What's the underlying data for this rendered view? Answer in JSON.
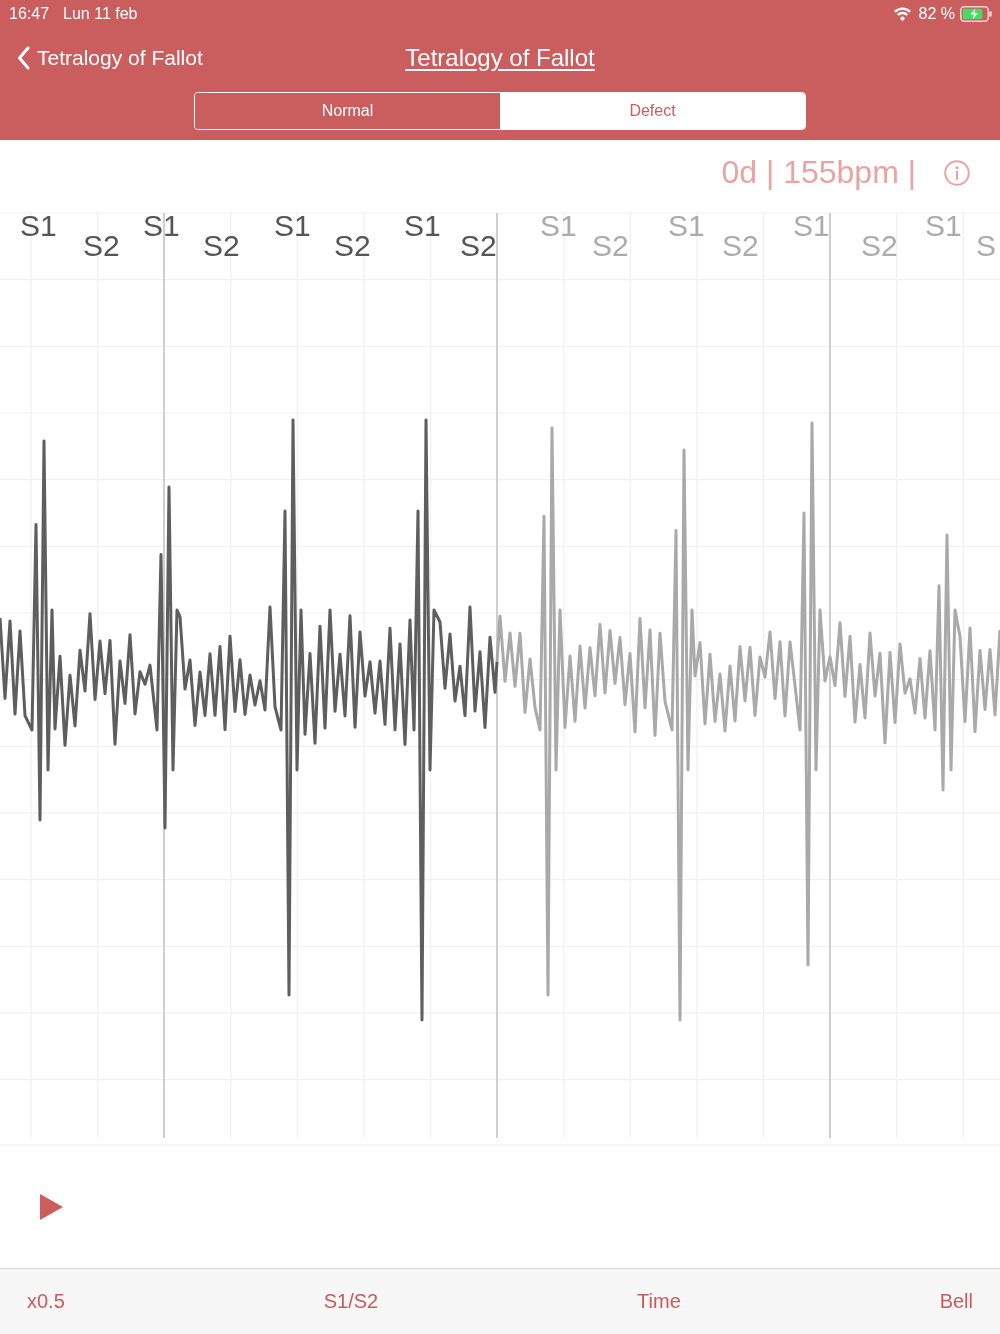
{
  "status_bar": {
    "time": "16:47",
    "date": "Lun 11 feb",
    "battery": "82 %"
  },
  "nav_bar": {
    "back_label": "Tetralogy of Fallot",
    "title": "Tetralogy of Fallot"
  },
  "segments": [
    {
      "label": "Normal",
      "selected": false
    },
    {
      "label": "Defect",
      "selected": true
    }
  ],
  "info": {
    "text": "0d | 155bpm |"
  },
  "recording": {
    "level": 0.497,
    "markers": [
      {
        "label": "S1",
        "played": true
      },
      {
        "label": "S2",
        "played": true
      },
      {
        "label": "S1",
        "played": true
      },
      {
        "label": "S2",
        "played": true
      },
      {
        "label": "S1",
        "played": true
      },
      {
        "label": "S2",
        "played": true
      },
      {
        "label": "S1",
        "played": true
      },
      {
        "label": "S2",
        "played": true
      },
      {
        "label": "S1",
        "played": false
      },
      {
        "label": "S2",
        "played": false
      },
      {
        "label": "S1",
        "played": false
      },
      {
        "label": "S2",
        "played": false
      },
      {
        "label": "S1",
        "played": false
      },
      {
        "label": "S2",
        "played": false
      },
      {
        "label": "S1",
        "played": false
      },
      {
        "label": "S",
        "played": false
      }
    ]
  },
  "toolbar": {
    "items": [
      "x0.5",
      "S1/S2",
      "Time",
      "Bell"
    ]
  }
}
